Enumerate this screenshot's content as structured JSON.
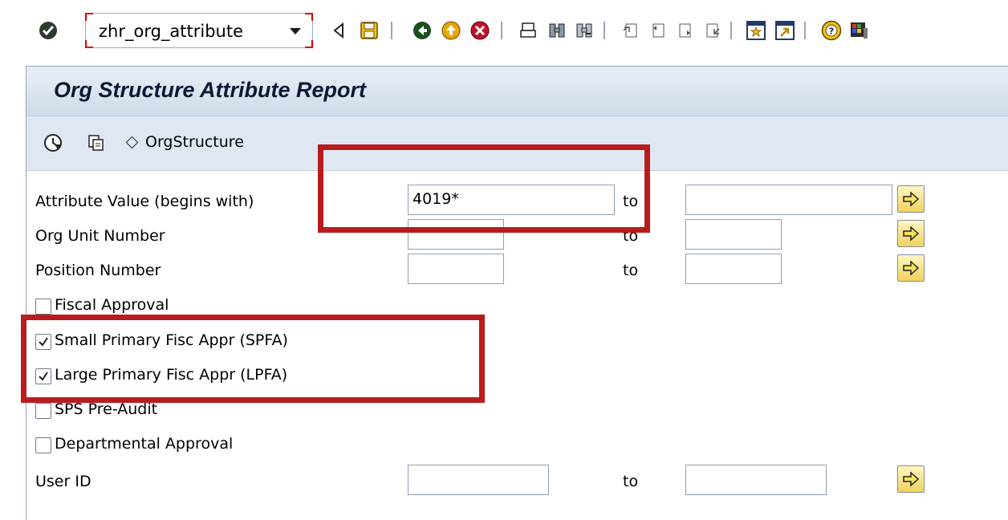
{
  "toolbar": {
    "command_field_value": "zhr_org_attribute",
    "icons": [
      "enter-icon",
      "back-triangle-icon",
      "save-icon",
      "back-icon",
      "exit-icon",
      "cancel-icon",
      "print-icon",
      "find-icon",
      "find-next-icon",
      "first-page-icon",
      "previous-page-icon",
      "next-page-icon",
      "last-page-icon",
      "create-session-icon",
      "shortcut-icon",
      "help-icon",
      "customize-layout-icon"
    ]
  },
  "page": {
    "title": "Org Structure Attribute Report"
  },
  "app_toolbar": {
    "execute_icon": "execute-icon",
    "variant_icon": "get-variant-icon",
    "orgstructure_label": "OrgStructure"
  },
  "form": {
    "attribute_value": {
      "label": "Attribute Value (begins with)",
      "from_value": "4019*",
      "to_label": "to",
      "to_value": ""
    },
    "org_unit": {
      "label": "Org Unit Number",
      "from_value": "",
      "to_label": "to",
      "to_value": ""
    },
    "position": {
      "label": "Position Number",
      "from_value": "",
      "to_label": "to",
      "to_value": ""
    },
    "checkboxes": [
      {
        "label": "Fiscal Approval",
        "checked": false
      },
      {
        "label": "Small Primary Fisc Appr (SPFA)",
        "checked": true
      },
      {
        "label": "Large Primary Fisc Appr (LPFA)",
        "checked": true
      },
      {
        "label": "SPS Pre-Audit",
        "checked": false
      },
      {
        "label": "Departmental Approval",
        "checked": false
      }
    ],
    "user_id": {
      "label": "User ID",
      "from_value": "",
      "to_label": "to",
      "to_value": ""
    }
  },
  "colors": {
    "annotation_red": "#b81c1c",
    "title_bar": "#d6e1ee",
    "multi_select_yellow": "#f2d25a"
  }
}
